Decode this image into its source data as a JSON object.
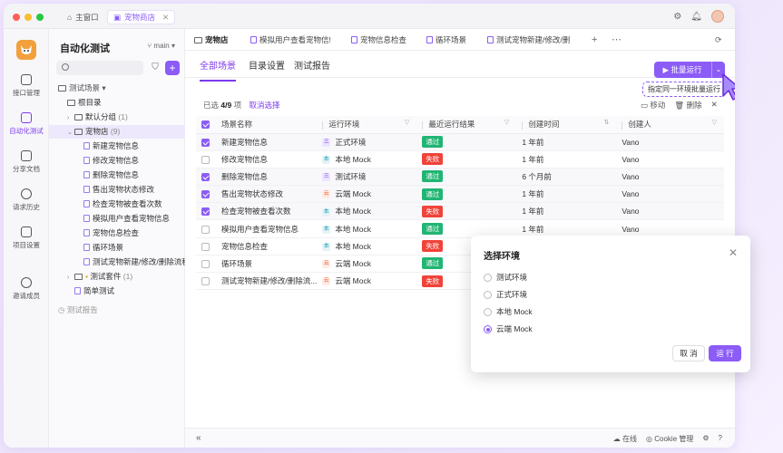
{
  "window": {
    "tabs": [
      {
        "label": "主窗口"
      },
      {
        "label": "宠物商店"
      }
    ]
  },
  "sidebar": {
    "items": [
      {
        "label": "接口管理",
        "icon": "api-icon"
      },
      {
        "label": "自动化测试",
        "icon": "automation-icon",
        "active": true
      },
      {
        "label": "分享文档",
        "icon": "share-doc-icon"
      },
      {
        "label": "请求历史",
        "icon": "history-icon"
      },
      {
        "label": "项目设置",
        "icon": "settings-icon"
      },
      {
        "label": "邀请成员",
        "icon": "invite-icon"
      }
    ]
  },
  "tree": {
    "title": "自动化测试",
    "branch": "main",
    "root_label": "测试场景",
    "rows": [
      {
        "label": "根目录",
        "count": ""
      },
      {
        "label": "默认分组",
        "count": "(1)"
      },
      {
        "label": "宠物店",
        "count": "(9)"
      },
      {
        "label": "新建宠物信息",
        "count": ""
      },
      {
        "label": "修改宠物信息",
        "count": ""
      },
      {
        "label": "删除宠物信息",
        "count": ""
      },
      {
        "label": "售出宠物状态修改",
        "count": ""
      },
      {
        "label": "检查宠物被查看次数",
        "count": ""
      },
      {
        "label": "模拟用户查看宠物信息",
        "count": ""
      },
      {
        "label": "宠物信息检查",
        "count": ""
      },
      {
        "label": "循环场景",
        "count": ""
      },
      {
        "label": "测试宠物新建/修改/删除流程",
        "count": ""
      },
      {
        "label": "测试套件",
        "count": "(1)"
      },
      {
        "label": "简单测试",
        "count": ""
      }
    ],
    "footer": "测试报告"
  },
  "file_tabs": [
    {
      "label": "宠物店"
    },
    {
      "label": "模拟用户查看宠物信!"
    },
    {
      "label": "宠物信息检查"
    },
    {
      "label": "循环场景"
    },
    {
      "label": "测试宠物新建/修改/删"
    }
  ],
  "content_tabs": [
    {
      "label": "全部场景"
    },
    {
      "label": "目录设置"
    },
    {
      "label": "测试报告"
    }
  ],
  "batch_run": {
    "label": "批量运行",
    "tooltip": "指定同一环境批量运行"
  },
  "selection": {
    "prefix": "已选",
    "count": "4/9",
    "suffix": "项",
    "cancel": "取消选择",
    "move": "移动",
    "delete": "删除"
  },
  "table": {
    "headers": [
      "场景名称",
      "运行环境",
      "最近运行结果",
      "创建时间",
      "创建人"
    ],
    "rows": [
      {
        "checked": true,
        "name": "新建宠物信息",
        "env": "正式环境",
        "env_type": "a",
        "result": "通过",
        "pass": true,
        "time": "1 年前",
        "creator": "Vano"
      },
      {
        "checked": false,
        "name": "修改宠物信息",
        "env": "本地 Mock",
        "env_type": "b",
        "result": "失败",
        "pass": false,
        "time": "1 年前",
        "creator": "Vano"
      },
      {
        "checked": true,
        "name": "删除宠物信息",
        "env": "测试环境",
        "env_type": "a",
        "result": "通过",
        "pass": true,
        "time": "6 个月前",
        "creator": "Vano"
      },
      {
        "checked": true,
        "name": "售出宠物状态修改",
        "env": "云端 Mock",
        "env_type": "c",
        "result": "通过",
        "pass": true,
        "time": "1 年前",
        "creator": "Vano"
      },
      {
        "checked": true,
        "name": "检查宠物被查看次数",
        "env": "本地 Mock",
        "env_type": "b",
        "result": "失败",
        "pass": false,
        "time": "1 年前",
        "creator": "Vano"
      },
      {
        "checked": false,
        "name": "模拟用户查看宠物信息",
        "env": "本地 Mock",
        "env_type": "b",
        "result": "通过",
        "pass": true,
        "time": "1 年前",
        "creator": "Vano"
      },
      {
        "checked": false,
        "name": "宠物信息检查",
        "env": "本地 Mock",
        "env_type": "b",
        "result": "失败",
        "pass": false,
        "time": "",
        "creator": ""
      },
      {
        "checked": false,
        "name": "循环场景",
        "env": "云端 Mock",
        "env_type": "c",
        "result": "通过",
        "pass": true,
        "time": "",
        "creator": ""
      },
      {
        "checked": false,
        "name": "测试宠物新建/修改/删除流...",
        "env": "云端 Mock",
        "env_type": "c",
        "result": "失败",
        "pass": false,
        "time": "",
        "creator": ""
      }
    ]
  },
  "env_icon_text": {
    "a": "三",
    "b": "本",
    "c": "云"
  },
  "dialog": {
    "title": "选择环境",
    "options": [
      {
        "label": "测试环境",
        "selected": false
      },
      {
        "label": "正式环境",
        "selected": false
      },
      {
        "label": "本地 Mock",
        "selected": false
      },
      {
        "label": "云端 Mock",
        "selected": true
      }
    ],
    "cancel": "取 消",
    "run": "运 行"
  },
  "statusbar": {
    "online": "在线",
    "cookie": "Cookie 管理"
  },
  "colors": {
    "accent": "#8b5cf6",
    "pass": "#21b573",
    "fail": "#f0433a"
  }
}
